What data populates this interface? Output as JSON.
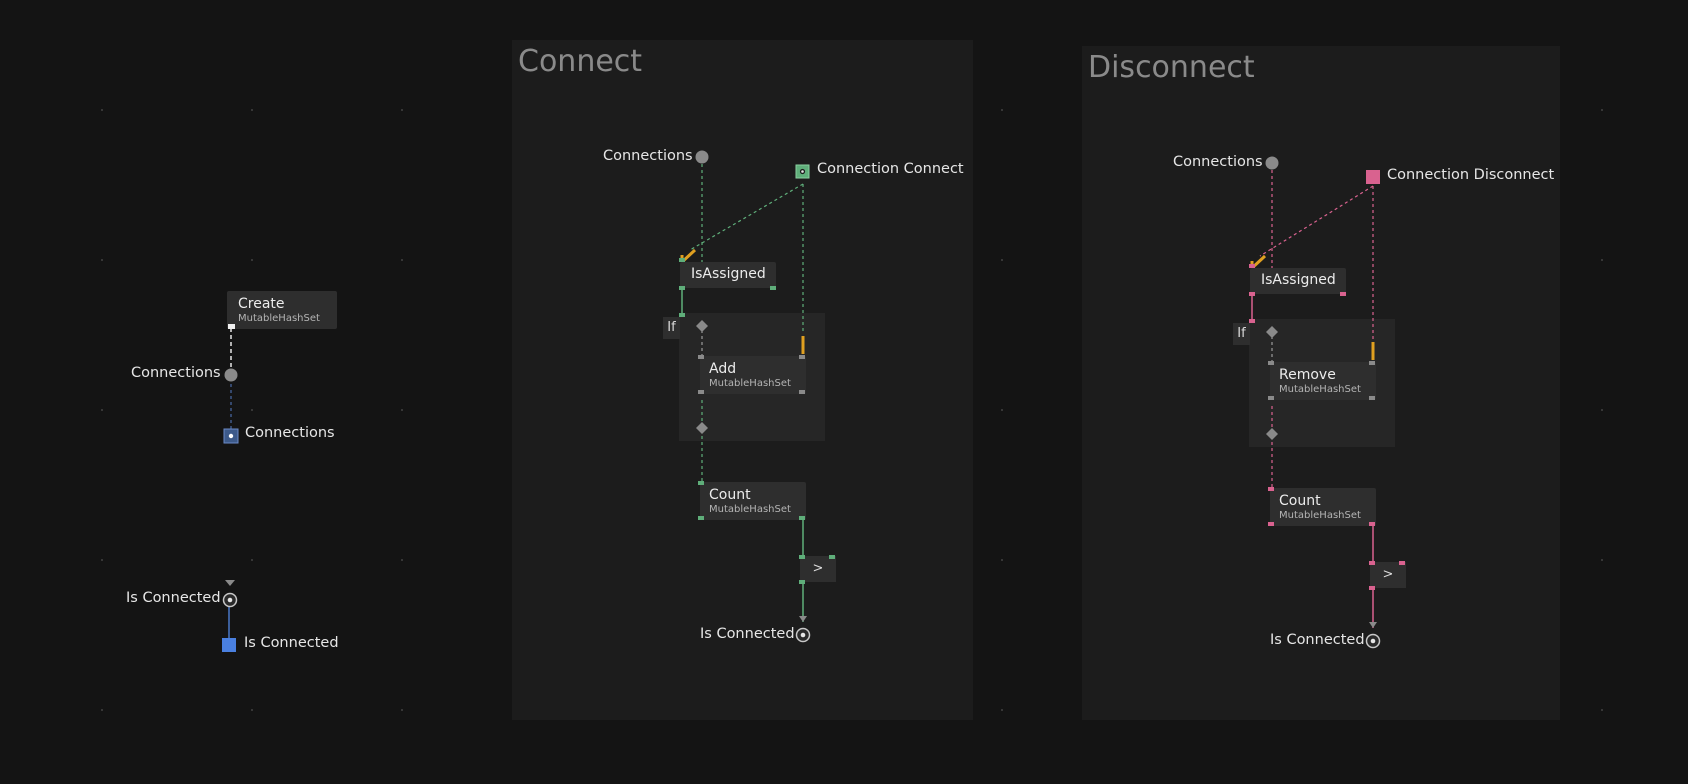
{
  "colors": {
    "background": "#141414",
    "frame": "#1c1c1c",
    "node": "#2e2e2e",
    "green": "#5fae7a",
    "pink": "#d9628f",
    "orange": "#e0a020",
    "blue": "#4a78c8",
    "gray_port": "#8a8a8a"
  },
  "left": {
    "create_node": {
      "title": "Create",
      "subtitle": "MutableHashSet"
    },
    "connections_var_label": "Connections",
    "connections_output_label": "Connections",
    "is_connected_var_label": "Is Connected",
    "is_connected_output_label": "Is Connected"
  },
  "connect": {
    "title": "Connect",
    "connections_label": "Connections",
    "event_label": "Connection Connect",
    "isassigned_node": "IsAssigned",
    "if_label": "If",
    "add_node": {
      "title": "Add",
      "subtitle": "MutableHashSet"
    },
    "count_node": {
      "title": "Count",
      "subtitle": "MutableHashSet"
    },
    "compare_label": ">",
    "is_connected_label": "Is Connected"
  },
  "disconnect": {
    "title": "Disconnect",
    "connections_label": "Connections",
    "event_label": "Connection Disconnect",
    "isassigned_node": "IsAssigned",
    "if_label": "If",
    "remove_node": {
      "title": "Remove",
      "subtitle": "MutableHashSet"
    },
    "count_node": {
      "title": "Count",
      "subtitle": "MutableHashSet"
    },
    "compare_label": ">",
    "is_connected_label": "Is Connected"
  }
}
